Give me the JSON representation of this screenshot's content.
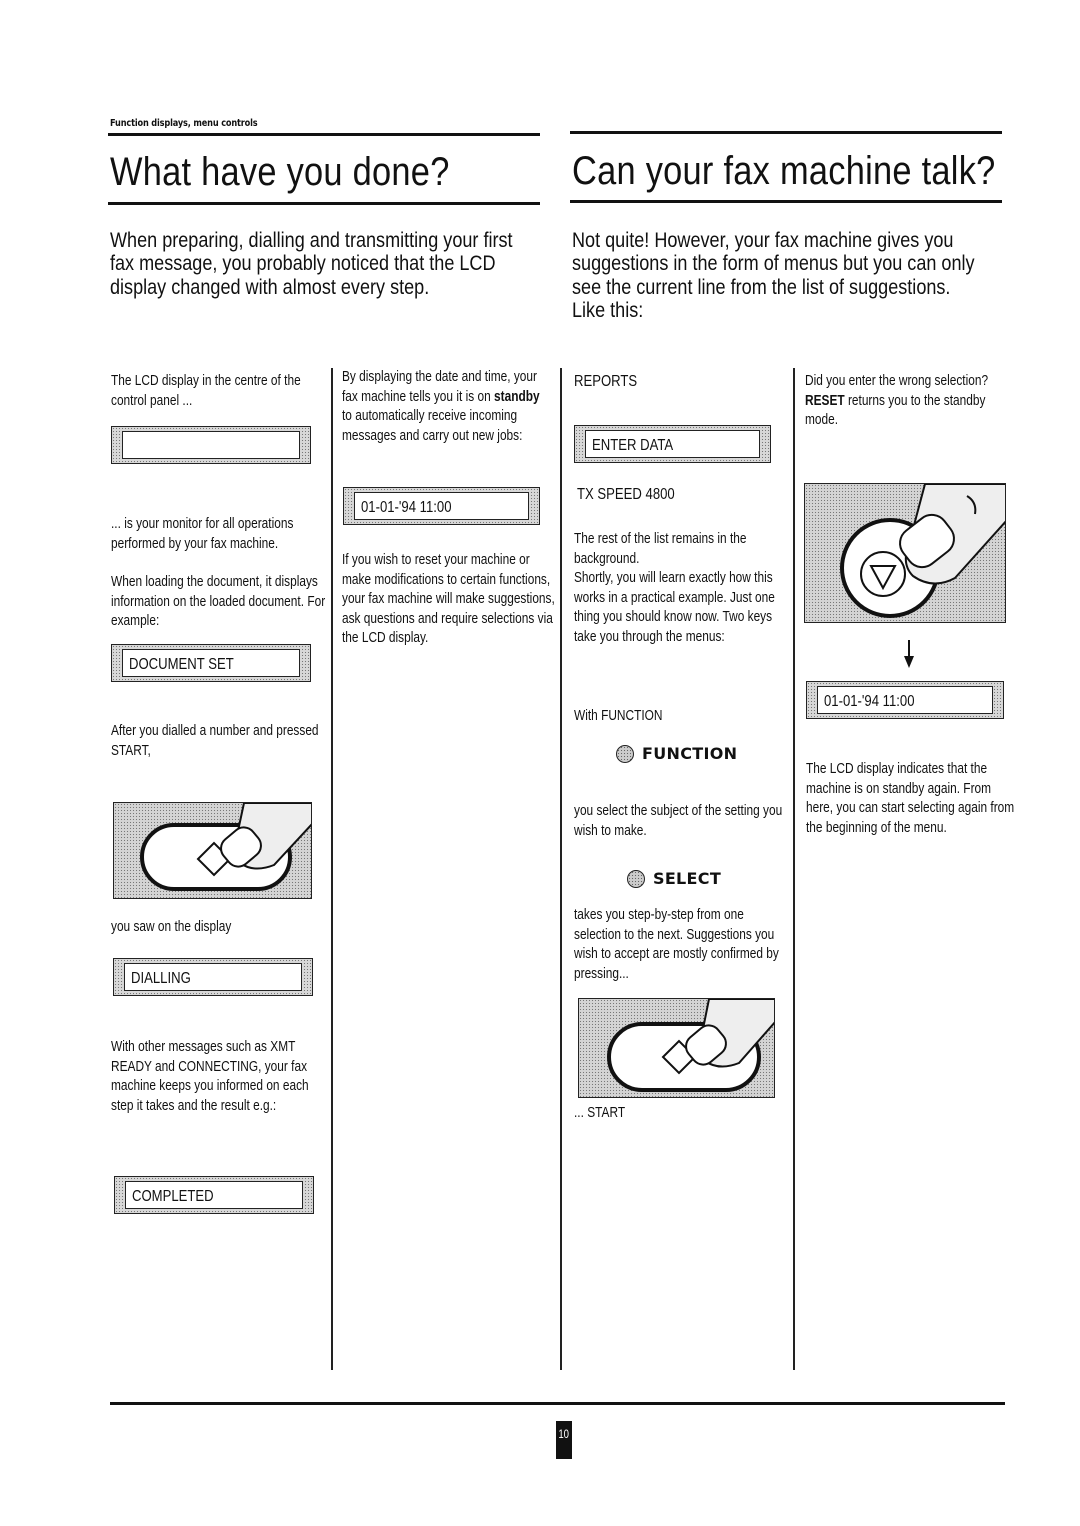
{
  "header": {
    "section_label": "Function displays, menu controls"
  },
  "left_section": {
    "title": "What have you done?",
    "intro": "When preparing, dialling and transmitting your first fax message, you probably noticed that the LCD display changed with almost every step.",
    "col1": {
      "p1": "The LCD display in the centre of the control panel ...",
      "lcd_blank": "",
      "p2": "... is your monitor for all operations performed by your fax machine.",
      "p3": "When loading the document, it displays information on the loaded document. For example:",
      "lcd_document": "DOCUMENT SET",
      "p4": "After you dialled a number and pressed START,",
      "illustration_start_key": "start-key-press",
      "p5": "you saw on the display",
      "lcd_dialling": "DIALLING",
      "p6": "With other messages such as XMT READY and CONNECTING, your fax machine keeps you informed on each step it takes and the result e.g.:",
      "lcd_completed": "COMPLETED"
    },
    "col2": {
      "p1_pre": "By displaying the date and time, your fax machine tells you it is on",
      "p1_bold": "standby",
      "p1_post": "to automatically receive incoming messages and carry out new jobs:",
      "lcd_datetime": "01-01-'94 11:00",
      "p2": "If you wish to reset your machine or make modifications to certain functions, your fax machine will make suggestions, ask questions and require selections via the LCD display."
    }
  },
  "right_section": {
    "title": "Can your fax machine talk?",
    "intro": "Not quite! However, your fax machine gives you suggestions in the form of menus but you can only see the current line from the list of suggestions. Like this:",
    "col3": {
      "menu_prev": "REPORTS",
      "lcd_current": "ENTER DATA",
      "menu_next": "TX SPEED 4800",
      "p1": "The rest of the list remains in the background.",
      "p2": "Shortly, you will learn exactly how this works in a practical example. Just one thing you should know now. Two keys take you through the menus:",
      "p3": "With FUNCTION",
      "key_function": "FUNCTION",
      "p4": "you select the subject of the setting you wish to make.",
      "key_select": "SELECT",
      "p5": "takes you step-by-step from one selection to the next. Suggestions you wish to accept are mostly confirmed by pressing...",
      "p6": "... START"
    },
    "col4": {
      "p1_pre": "Did you enter the wrong selection?",
      "p1_bold": "RESET",
      "p1_post": "returns you to the standby mode.",
      "lcd_datetime": "01-01-'94 11:00",
      "p2": "The LCD display indicates that the machine is on standby again. From here, you can start selecting again from the beginning of the menu."
    }
  },
  "footer": {
    "page_number": "10"
  }
}
